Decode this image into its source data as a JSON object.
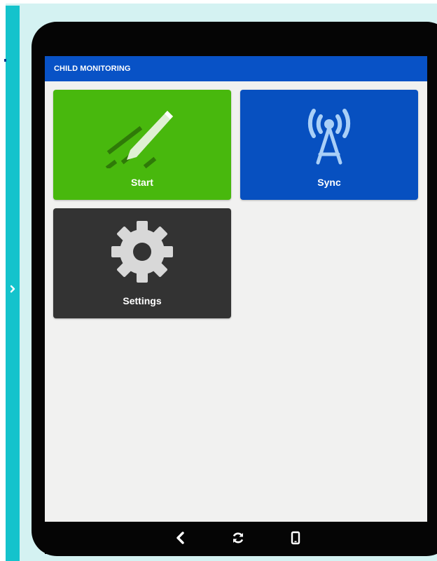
{
  "app": {
    "title": "CHILD MONITORING"
  },
  "tiles": [
    {
      "label": "Start",
      "icon": "pencil-icon",
      "color": "#48b80d"
    },
    {
      "label": "Sync",
      "icon": "antenna-icon",
      "color": "#0750c0"
    },
    {
      "label": "Settings",
      "icon": "gear-icon",
      "color": "#333333"
    }
  ],
  "sidebar": {
    "toggle_icon": "chevron-right-icon",
    "accent": "#14c3cc"
  },
  "navbar": {
    "buttons": [
      {
        "icon": "back-icon"
      },
      {
        "icon": "refresh-icon"
      },
      {
        "icon": "device-icon"
      }
    ]
  },
  "colors": {
    "appbar": "#0852c6",
    "screen_bg": "#f1f1f0",
    "frame": "#050505",
    "page_bg": "#d4f2f2"
  }
}
